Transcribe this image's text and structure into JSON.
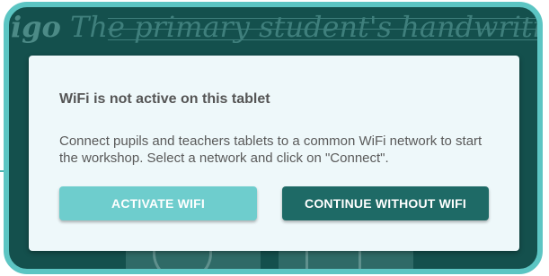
{
  "background": {
    "app_title_logo": "igo",
    "app_title_text": "The primary student's handwriting"
  },
  "dialog": {
    "title": "WiFi is not active on this tablet",
    "body": "Connect pupils and teachers tablets to a common WiFi network to start the workshop. Select a network and click on \"Connect\".",
    "activate_button": "ACTIVATE WIFI",
    "continue_button": "CONTINUE WITHOUT WIFI"
  },
  "colors": {
    "frame": "#5cc5c3",
    "app_background": "#14504d",
    "dialog_background": "#eef8fa",
    "activate_button": "#6ecdcd",
    "continue_button": "#1e6a66"
  }
}
